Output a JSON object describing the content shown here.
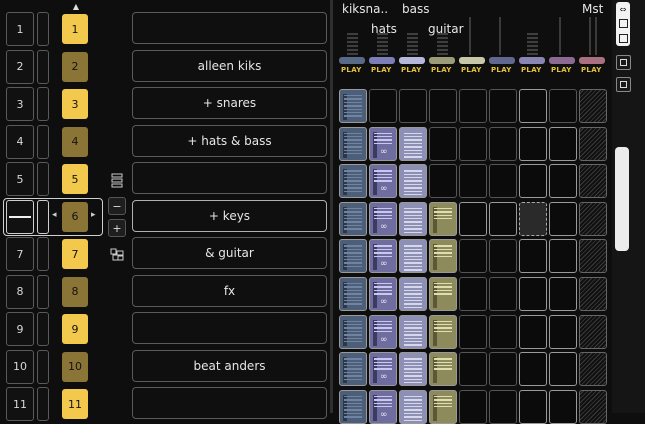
{
  "scenes": {
    "numbers": [
      "1",
      "2",
      "3",
      "4",
      "5",
      "6",
      "7",
      "8",
      "9",
      "10",
      "11"
    ],
    "yellow": [
      "1",
      "2",
      "3",
      "4",
      "5",
      "6",
      "7",
      "8",
      "9",
      "10",
      "11"
    ],
    "names": [
      "",
      "alleen kiks",
      "+ snares",
      "+ hats & bass",
      "",
      "+ keys",
      "& guitar",
      "fx",
      "",
      "beat anders",
      ""
    ],
    "scroll_arrow": "▲"
  },
  "side_buttons": {
    "minus": "−",
    "plus": "+",
    "left_arrow": "◂",
    "right_arrow": "▸"
  },
  "tracks": {
    "labels": [
      "kiksna..",
      "hats",
      "bass",
      "guitar",
      "Mst"
    ],
    "play_label": "PLAY",
    "play_count": 9,
    "strip_colors": [
      "#596a86",
      "#7c7eb8",
      "#b6b8dc",
      "#9c9c78",
      "#c8c8a8",
      "#606890",
      "#8a86b4",
      "#8c6a92",
      "#a87080"
    ]
  },
  "clip_colors": {
    "kick": "#4c5e78",
    "hats": "#6f6d9f",
    "bass": "#8e8fb5",
    "guitar": "#8d8a5c"
  },
  "right_panel": {
    "icon_label": "⇔"
  }
}
